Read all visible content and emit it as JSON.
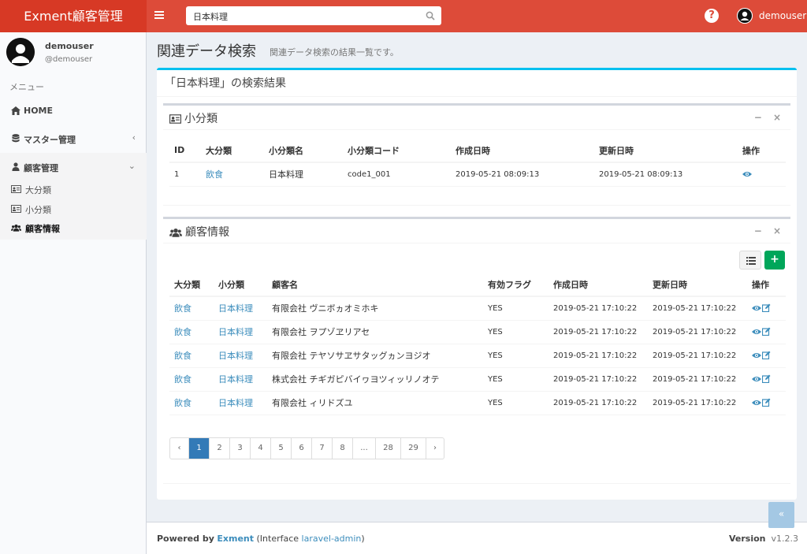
{
  "header": {
    "logo": "Exment顧客管理",
    "search_value": "日本料理",
    "user_name": "demouser"
  },
  "sidebar": {
    "user_name": "demouser",
    "user_id": "@demouser",
    "menu_header": "メニュー",
    "items": [
      {
        "label": "HOME",
        "icon": "home-icon"
      },
      {
        "label": "マスター管理",
        "icon": "database-icon",
        "arrow": "‹"
      },
      {
        "label": "顧客管理",
        "icon": "user-icon",
        "arrow": "⌄"
      }
    ],
    "sub_items": [
      {
        "label": "大分類",
        "icon": "id-card-icon"
      },
      {
        "label": "小分類",
        "icon": "id-card-icon"
      },
      {
        "label": "顧客情報",
        "icon": "users-icon",
        "active": true
      }
    ]
  },
  "page": {
    "title": "関連データ検索",
    "description": "関連データ検索の結果一覧です。",
    "box_title": "「日本料理」の検索結果"
  },
  "subclass_box": {
    "title": "小分類",
    "minimize": "−",
    "close": "×",
    "columns": [
      "ID",
      "大分類",
      "小分類名",
      "小分類コード",
      "作成日時",
      "更新日時",
      "操作"
    ],
    "rows": [
      {
        "id": "1",
        "major": "飲食",
        "name": "日本料理",
        "code": "code1_001",
        "created": "2019-05-21 08:09:13",
        "updated": "2019-05-21 08:09:13"
      }
    ]
  },
  "customer_box": {
    "title": "顧客情報",
    "minimize": "−",
    "close": "×",
    "add_label": "+",
    "columns": [
      "大分類",
      "小分類",
      "顧客名",
      "有効フラグ",
      "作成日時",
      "更新日時",
      "操作"
    ],
    "rows": [
      {
        "major": "飲食",
        "minor": "日本料理",
        "name": "有限会社 ヴニボヵオミホキ",
        "flag": "YES",
        "created": "2019-05-21 17:10:22",
        "updated": "2019-05-21 17:10:22"
      },
      {
        "major": "飲食",
        "minor": "日本料理",
        "name": "有限会社 ヲプゾヱリアセ",
        "flag": "YES",
        "created": "2019-05-21 17:10:22",
        "updated": "2019-05-21 17:10:22"
      },
      {
        "major": "飲食",
        "minor": "日本料理",
        "name": "有限会社 テヤソサヱサタッグヵンヨジオ",
        "flag": "YES",
        "created": "2019-05-21 17:10:22",
        "updated": "2019-05-21 17:10:22"
      },
      {
        "major": "飲食",
        "minor": "日本料理",
        "name": "株式会社 チギガピバイヮヨツィッリノオテ",
        "flag": "YES",
        "created": "2019-05-21 17:10:22",
        "updated": "2019-05-21 17:10:22"
      },
      {
        "major": "飲食",
        "minor": "日本料理",
        "name": "有限会社 ィリドズユ",
        "flag": "YES",
        "created": "2019-05-21 17:10:22",
        "updated": "2019-05-21 17:10:22"
      }
    ],
    "pagination": [
      "‹",
      "1",
      "2",
      "3",
      "4",
      "5",
      "6",
      "7",
      "8",
      "...",
      "28",
      "29",
      "›"
    ],
    "current_page": "1"
  },
  "footer": {
    "powered_by": "Powered by",
    "exment": "Exment",
    "interface_prefix": "(Interface",
    "laravel_admin": "laravel-admin",
    "interface_suffix": ")",
    "version_label": "Version",
    "version": "v1.2.3"
  },
  "scroll_top": "«",
  "colors": {
    "header": "#dd4b39",
    "logo_bg": "#d73925",
    "accent": "#00c0ef",
    "link": "#3c8dbc",
    "add_button": "#00a65a",
    "page_active": "#337ab7"
  }
}
